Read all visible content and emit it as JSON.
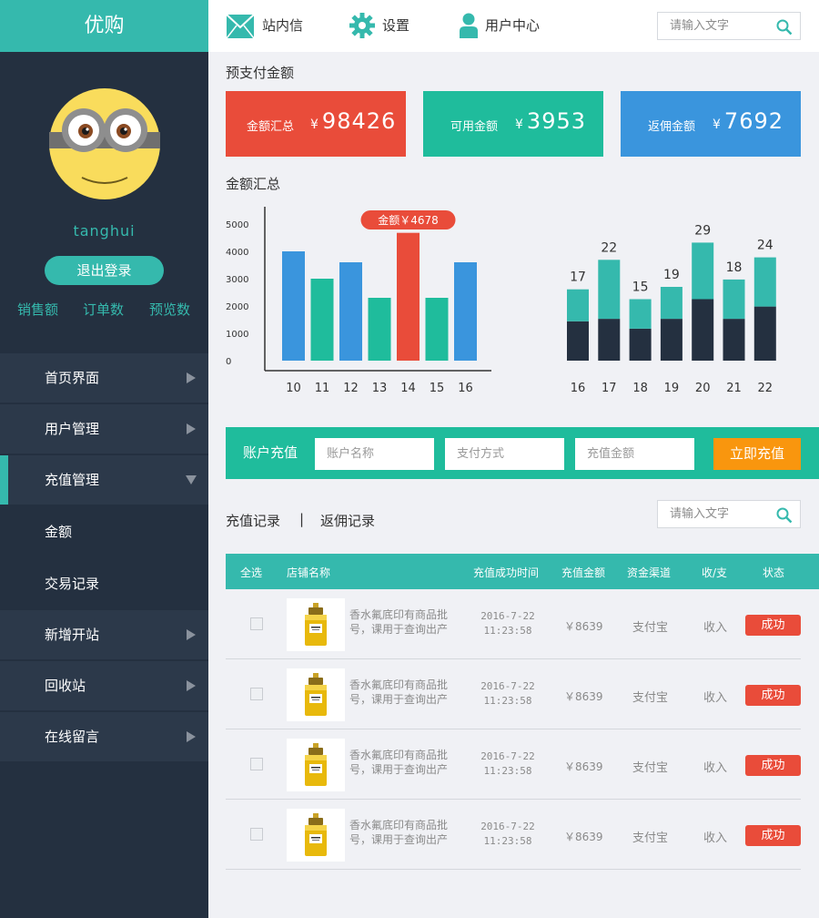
{
  "app": {
    "title": "优购"
  },
  "user": {
    "name": "tanghui",
    "logout_label": "退出登录"
  },
  "stats": [
    "销售额",
    "订单数",
    "预览数"
  ],
  "nav": {
    "items": [
      {
        "label": "首页界面",
        "expanded": false
      },
      {
        "label": "用户管理",
        "expanded": false
      },
      {
        "label": "充值管理",
        "expanded": true,
        "children": [
          "金额",
          "交易记录"
        ]
      },
      {
        "label": "新增开站",
        "expanded": false
      },
      {
        "label": "回收站",
        "expanded": false
      },
      {
        "label": "在线留言",
        "expanded": false
      }
    ]
  },
  "topbar": {
    "messages_label": "站内信",
    "settings_label": "设置",
    "user_center_label": "用户中心",
    "search_placeholder": "请输入文字"
  },
  "prepay": {
    "title": "预支付金额",
    "cards": [
      {
        "label": "金额汇总",
        "currency": "¥",
        "value": "98426",
        "color": "#e94c3a"
      },
      {
        "label": "可用金额",
        "currency": "¥",
        "value": "3953",
        "color": "#1fbc9c"
      },
      {
        "label": "返佣金额",
        "currency": "¥",
        "value": "7692",
        "color": "#3a95dd"
      }
    ]
  },
  "summary_title": "金额汇总",
  "chart_data": [
    {
      "type": "bar",
      "categories": [
        "10",
        "11",
        "12",
        "13",
        "14",
        "15",
        "16"
      ],
      "values": [
        4000,
        3000,
        3600,
        2300,
        4678,
        2300,
        3600
      ],
      "colors": [
        "#3a95dd",
        "#1fbc9c",
        "#3a95dd",
        "#1fbc9c",
        "#e94c3a",
        "#1fbc9c",
        "#3a95dd"
      ],
      "yticks": [
        "0",
        "1000",
        "2000",
        "3000",
        "4000",
        "5000"
      ],
      "ylim": [
        0,
        5000
      ],
      "highlight": {
        "index": 4,
        "label": "金额￥4678"
      }
    },
    {
      "type": "bar",
      "stacked": true,
      "categories": [
        "16",
        "17",
        "18",
        "19",
        "20",
        "21",
        "22"
      ],
      "totals": [
        "17",
        "22",
        "15",
        "19",
        "29",
        "18",
        "24"
      ],
      "series": [
        {
          "values": [
            8,
            8.5,
            6.5,
            8.5,
            12.5,
            8.5,
            11
          ],
          "color": "#243040"
        },
        {
          "values": [
            6.5,
            12,
            6,
            6.5,
            11.5,
            8,
            10
          ],
          "color": "#35b9ad"
        }
      ]
    }
  ],
  "recharge": {
    "title": "账户充值",
    "account_placeholder": "账户名称",
    "payment_placeholder": "支付方式",
    "amount_placeholder": "充值金额",
    "submit_label": "立即充值"
  },
  "records": {
    "tab_recharge": "充值记录",
    "separator": "|",
    "tab_rebate": "返佣记录",
    "search_placeholder": "请输入文字",
    "columns": [
      "全选",
      "店铺名称",
      "充值成功时间",
      "充值金额",
      "资金渠道",
      "收/支",
      "状态"
    ],
    "rows": [
      {
        "desc1": "香水氟底印有商品批",
        "desc2": "号，课用于查询出产",
        "date": "2016-7-22",
        "time": "11:23:58",
        "amount": "￥8639",
        "channel": "支付宝",
        "type": "收入",
        "status": "成功"
      },
      {
        "desc1": "香水氟底印有商品批",
        "desc2": "号，课用于查询出产",
        "date": "2016-7-22",
        "time": "11:23:58",
        "amount": "￥8639",
        "channel": "支付宝",
        "type": "收入",
        "status": "成功"
      },
      {
        "desc1": "香水氟底印有商品批",
        "desc2": "号，课用于查询出产",
        "date": "2016-7-22",
        "time": "11:23:58",
        "amount": "￥8639",
        "channel": "支付宝",
        "type": "收入",
        "status": "成功"
      },
      {
        "desc1": "香水氟底印有商品批",
        "desc2": "号，课用于查询出产",
        "date": "2016-7-22",
        "time": "11:23:58",
        "amount": "￥8639",
        "channel": "支付宝",
        "type": "收入",
        "status": "成功"
      }
    ]
  }
}
